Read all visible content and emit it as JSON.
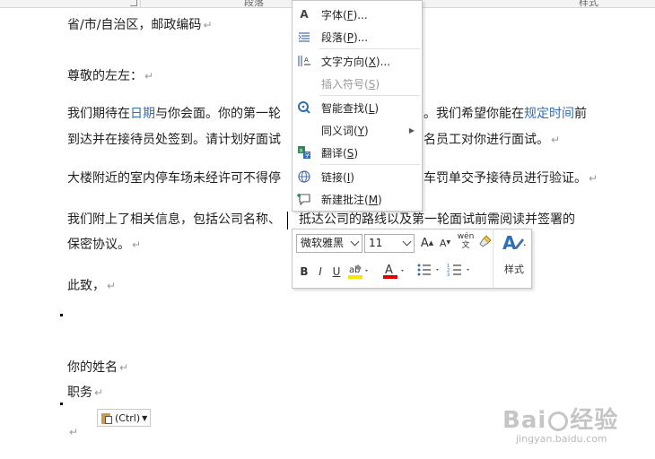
{
  "ribbon": {
    "group_paragraph": "段落",
    "group_styles": "样式"
  },
  "document": {
    "line1": "省/市/自治区，邮政编码",
    "greeting": "尊敬的左左：",
    "p1a_pre": "我们期待在",
    "p1a_link1": "日期",
    "p1a_mid": "与你会面。你的第一轮",
    "p1a_after": "。我们希望你能在",
    "p1a_link2": "规定时间",
    "p1a_end": "前",
    "p1b_left": "到达并在接待员处签到。请计划好面试",
    "p1b_right": "名员工对你进行面试。",
    "p2_left": "大楼附近的室内停车场未经许可不得停",
    "p2_right": "车罚单交予接待员进行验证。",
    "p3a_left": "我们附上了相关信息，包括公司名称、",
    "p3a_right": "抵达公司的路线以及第一轮面试前需阅读并签署的",
    "p3b": "保密协议。",
    "closing": "此致，",
    "your_name": "你的姓名",
    "position": "职务",
    "paragraph_mark": "↵"
  },
  "paste_options": {
    "label": "(Ctrl)"
  },
  "context_menu": {
    "items": [
      {
        "label": "字体(",
        "key": "F",
        "tail": ")...",
        "icon": "font-icon"
      },
      {
        "label": "段落(",
        "key": "P",
        "tail": ")...",
        "icon": "paragraph-icon"
      },
      {
        "label": "文字方向(",
        "key": "X",
        "tail": ")...",
        "icon": "text-direction-icon"
      },
      {
        "label": "插入符号(",
        "key": "S",
        "tail": ")",
        "icon": ""
      },
      {
        "label": "智能查找(",
        "key": "L",
        "tail": ")",
        "icon": "smart-lookup-icon"
      },
      {
        "label": "同义词(",
        "key": "Y",
        "tail": ")",
        "icon": ""
      },
      {
        "label": "翻译(",
        "key": "S",
        "tail": ")",
        "icon": "translate-icon"
      },
      {
        "label": "链接(",
        "key": "I",
        "tail": ")",
        "icon": "link-icon"
      },
      {
        "label": "新建批注(",
        "key": "M",
        "tail": ")",
        "icon": "new-comment-icon"
      }
    ]
  },
  "mini_toolbar": {
    "font_name": "微软雅黑",
    "font_size": "11",
    "grow_font": "A",
    "shrink_font": "A",
    "phonetic": "wén文",
    "bold": "B",
    "italic": "I",
    "underline": "U",
    "font_color": "A",
    "styles_label": "样式",
    "highlight_color": "#f5e600",
    "font_color_value": "#e00000"
  },
  "watermark": {
    "brand": "Bai",
    "brand2": "经验",
    "url": "jingyan.baidu.com"
  }
}
